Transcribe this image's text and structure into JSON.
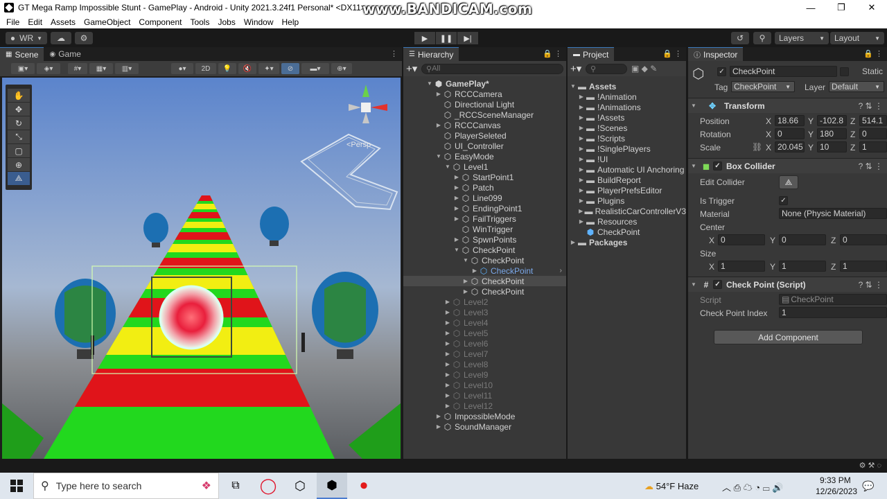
{
  "window": {
    "title": "GT Mega Ramp Impossible Stunt - GamePlay - Android - Unity 2021.3.24f1 Personal* <DX11>",
    "watermark": "www.BANDICAM.com",
    "minimize": "—",
    "maximize": "❐",
    "close": "✕"
  },
  "menu": [
    "File",
    "Edit",
    "Assets",
    "GameObject",
    "Component",
    "Tools",
    "Jobs",
    "Window",
    "Help"
  ],
  "toolbar": {
    "account": "WR",
    "layers": "Layers",
    "layout": "Layout"
  },
  "tabs": {
    "scene": "Scene",
    "game": "Game",
    "hierarchy": "Hierarchy",
    "project": "Project",
    "inspector": "Inspector"
  },
  "scene": {
    "mode_2d": "2D",
    "persp_label": "<Persp"
  },
  "hierarchy": {
    "search_placeholder": "All",
    "items": [
      {
        "label": "GamePlay*",
        "depth": 0,
        "arrow": "▼",
        "style": "scene"
      },
      {
        "label": "RCCCamera",
        "depth": 1,
        "arrow": "▶",
        "style": ""
      },
      {
        "label": "Directional Light",
        "depth": 1,
        "arrow": "",
        "style": ""
      },
      {
        "label": "_RCCSceneManager",
        "depth": 1,
        "arrow": "",
        "style": ""
      },
      {
        "label": "RCCCanvas",
        "depth": 1,
        "arrow": "▶",
        "style": ""
      },
      {
        "label": "PlayerSeleted",
        "depth": 1,
        "arrow": "",
        "style": ""
      },
      {
        "label": "UI_Controller",
        "depth": 1,
        "arrow": "",
        "style": ""
      },
      {
        "label": "EasyMode",
        "depth": 1,
        "arrow": "▼",
        "style": ""
      },
      {
        "label": "Level1",
        "depth": 2,
        "arrow": "▼",
        "style": ""
      },
      {
        "label": "StartPoint1",
        "depth": 3,
        "arrow": "▶",
        "style": ""
      },
      {
        "label": "Patch",
        "depth": 3,
        "arrow": "▶",
        "style": ""
      },
      {
        "label": "Line099",
        "depth": 3,
        "arrow": "▶",
        "style": ""
      },
      {
        "label": "EndingPoint1",
        "depth": 3,
        "arrow": "▶",
        "style": ""
      },
      {
        "label": "FailTriggers",
        "depth": 3,
        "arrow": "▶",
        "style": ""
      },
      {
        "label": "WinTrigger",
        "depth": 3,
        "arrow": "",
        "style": ""
      },
      {
        "label": "SpwnPoints",
        "depth": 3,
        "arrow": "▶",
        "style": ""
      },
      {
        "label": "CheckPoint",
        "depth": 3,
        "arrow": "▼",
        "style": ""
      },
      {
        "label": "CheckPoint",
        "depth": 4,
        "arrow": "▼",
        "style": ""
      },
      {
        "label": "CheckPoint",
        "depth": 5,
        "arrow": "▶",
        "style": "blue"
      },
      {
        "label": "CheckPoint",
        "depth": 4,
        "arrow": "▶",
        "style": "selected"
      },
      {
        "label": "CheckPoint",
        "depth": 4,
        "arrow": "▶",
        "style": ""
      },
      {
        "label": "Level2",
        "depth": 2,
        "arrow": "▶",
        "style": "dim"
      },
      {
        "label": "Level3",
        "depth": 2,
        "arrow": "▶",
        "style": "dim"
      },
      {
        "label": "Level4",
        "depth": 2,
        "arrow": "▶",
        "style": "dim"
      },
      {
        "label": "Level5",
        "depth": 2,
        "arrow": "▶",
        "style": "dim"
      },
      {
        "label": "Level6",
        "depth": 2,
        "arrow": "▶",
        "style": "dim"
      },
      {
        "label": "Level7",
        "depth": 2,
        "arrow": "▶",
        "style": "dim"
      },
      {
        "label": "Level8",
        "depth": 2,
        "arrow": "▶",
        "style": "dim"
      },
      {
        "label": "Level9",
        "depth": 2,
        "arrow": "▶",
        "style": "dim"
      },
      {
        "label": "Level10",
        "depth": 2,
        "arrow": "▶",
        "style": "dim"
      },
      {
        "label": "Level11",
        "depth": 2,
        "arrow": "▶",
        "style": "dim"
      },
      {
        "label": "Level12",
        "depth": 2,
        "arrow": "▶",
        "style": "dim"
      },
      {
        "label": "ImpossibleMode",
        "depth": 1,
        "arrow": "▶",
        "style": ""
      },
      {
        "label": "SoundManager",
        "depth": 1,
        "arrow": "▶",
        "style": ""
      }
    ]
  },
  "project": {
    "items": [
      {
        "label": "Assets",
        "depth": 0,
        "arrow": "▼",
        "kind": "folder",
        "bold": true
      },
      {
        "label": "!Animation",
        "depth": 1,
        "arrow": "▶",
        "kind": "folder"
      },
      {
        "label": "!Animations",
        "depth": 1,
        "arrow": "▶",
        "kind": "folder"
      },
      {
        "label": "!Assets",
        "depth": 1,
        "arrow": "▶",
        "kind": "folder"
      },
      {
        "label": "!Scenes",
        "depth": 1,
        "arrow": "▶",
        "kind": "folder"
      },
      {
        "label": "!Scripts",
        "depth": 1,
        "arrow": "▶",
        "kind": "folder"
      },
      {
        "label": "!SinglePlayers",
        "depth": 1,
        "arrow": "▶",
        "kind": "folder"
      },
      {
        "label": "!UI",
        "depth": 1,
        "arrow": "▶",
        "kind": "folder"
      },
      {
        "label": "Automatic UI Anchoring",
        "depth": 1,
        "arrow": "▶",
        "kind": "folder"
      },
      {
        "label": "BuildReport",
        "depth": 1,
        "arrow": "▶",
        "kind": "folder"
      },
      {
        "label": "PlayerPrefsEditor",
        "depth": 1,
        "arrow": "▶",
        "kind": "folder"
      },
      {
        "label": "Plugins",
        "depth": 1,
        "arrow": "▶",
        "kind": "folder"
      },
      {
        "label": "RealisticCarControllerV3",
        "depth": 1,
        "arrow": "▶",
        "kind": "folder"
      },
      {
        "label": "Resources",
        "depth": 1,
        "arrow": "▶",
        "kind": "folder"
      },
      {
        "label": "CheckPoint",
        "depth": 1,
        "arrow": "",
        "kind": "prefab"
      },
      {
        "label": "Packages",
        "depth": 0,
        "arrow": "▶",
        "kind": "folder",
        "bold": true
      }
    ]
  },
  "inspector": {
    "object_name": "CheckPoint",
    "static_label": "Static",
    "tag_label": "Tag",
    "tag_value": "CheckPoint",
    "layer_label": "Layer",
    "layer_value": "Default",
    "transform": {
      "title": "Transform",
      "position_label": "Position",
      "rotation_label": "Rotation",
      "scale_label": "Scale",
      "position": {
        "x": "18.66",
        "y": "-102.8",
        "z": "514.1"
      },
      "rotation": {
        "x": "0",
        "y": "180",
        "z": "0"
      },
      "scale": {
        "x": "20.045",
        "y": "10",
        "z": "1"
      }
    },
    "box_collider": {
      "title": "Box Collider",
      "edit_collider_label": "Edit Collider",
      "is_trigger_label": "Is Trigger",
      "is_trigger": "✓",
      "material_label": "Material",
      "material_value": "None (Physic Material)",
      "center_label": "Center",
      "center": {
        "x": "0",
        "y": "0",
        "z": "0"
      },
      "size_label": "Size",
      "size": {
        "x": "1",
        "y": "1",
        "z": "1"
      }
    },
    "script_comp": {
      "title": "Check Point (Script)",
      "script_label": "Script",
      "script_value": "CheckPoint",
      "index_label": "Check Point Index",
      "index_value": "1"
    },
    "add_component": "Add Component",
    "axis_x": "X",
    "axis_y": "Y",
    "axis_z": "Z"
  },
  "taskbar": {
    "search_placeholder": "Type here to search",
    "weather": "54°F  Haze",
    "time": "9:33 PM",
    "date": "12/26/2023"
  },
  "colors": {
    "accent": "#3a79bb",
    "selection": "#2c5d87",
    "panel_bg": "#383838",
    "track_red": "#e0141a",
    "track_yellow": "#f2ee12",
    "track_green": "#22d81e"
  }
}
